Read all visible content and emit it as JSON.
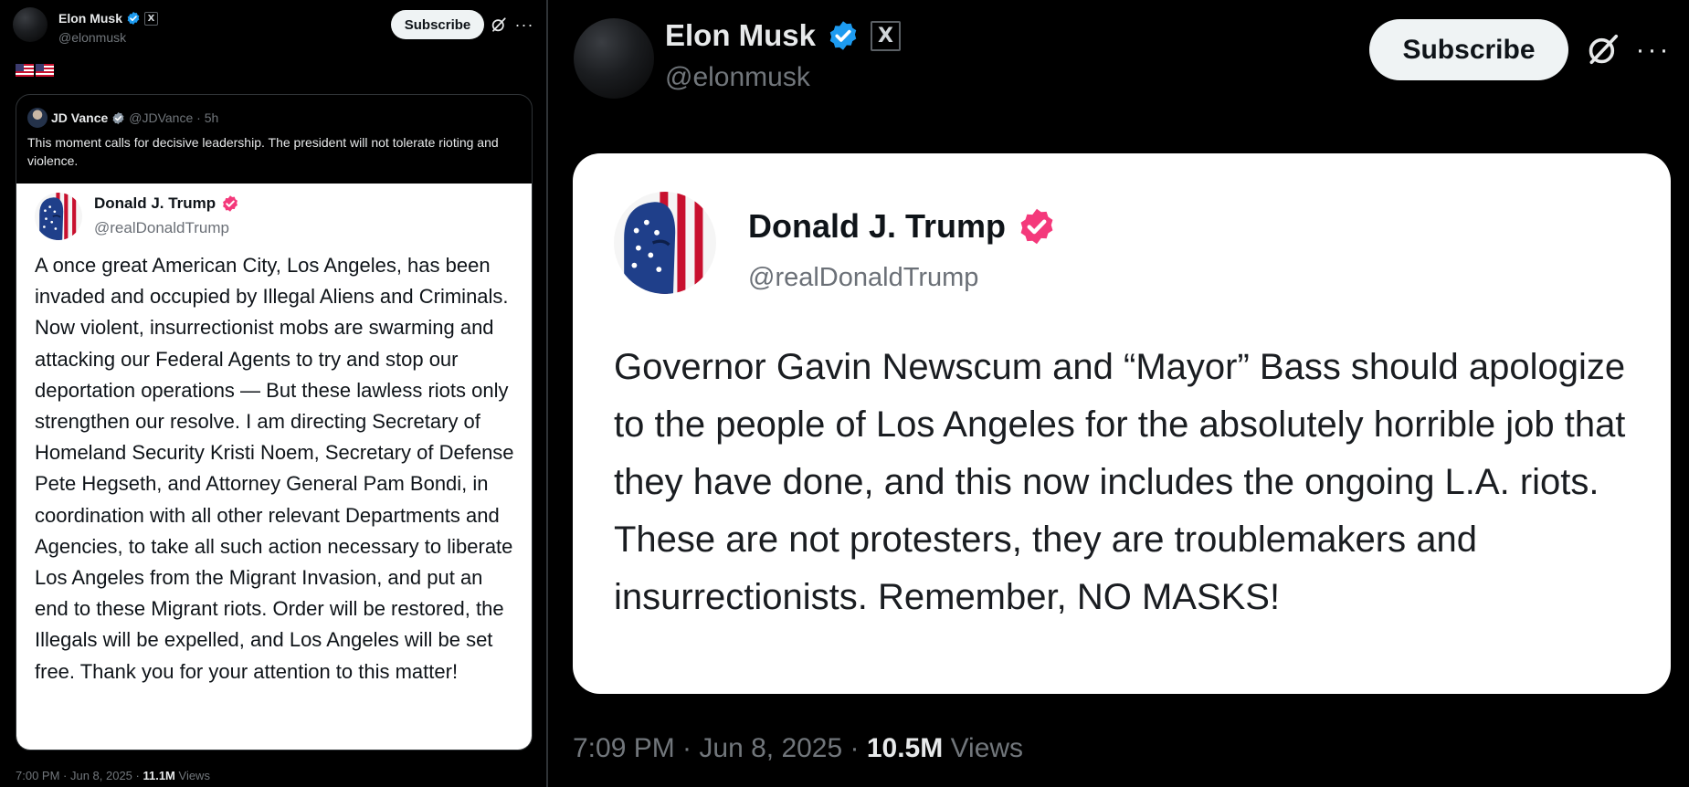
{
  "left": {
    "author": {
      "name": "Elon Musk",
      "handle": "@elonmusk",
      "affiliate_badge": "X"
    },
    "subscribe_label": "Subscribe",
    "more_label": "···",
    "flags": [
      "us-flag",
      "us-flag"
    ],
    "quote": {
      "name": "JD Vance",
      "handle": "@JDVance",
      "time": "· 5h",
      "text": "This moment calls for decisive leadership. The president will not tolerate rioting and violence."
    },
    "card": {
      "name": "Donald J. Trump",
      "handle": "@realDonaldTrump",
      "text": "A once great American City, Los Angeles, has been invaded and occupied by Illegal Aliens and Criminals.  Now violent, insurrectionist mobs are swarming and attacking our Federal Agents to try and stop our deportation operations — But these lawless riots only strengthen our resolve. I am directing Secretary of Homeland Security Kristi Noem, Secretary of Defense Pete Hegseth, and Attorney General Pam Bondi, in coordination with all other relevant Departments and Agencies, to take all such action necessary to liberate Los Angeles from the Migrant Invasion, and put an end to these Migrant riots. Order will be restored, the Illegals will be expelled, and Los Angeles will be set free. Thank you for your attention to this matter!"
    },
    "footer": {
      "time": "7:00 PM · Jun 8, 2025 · ",
      "views_count": "11.1M",
      "views_label": " Views"
    }
  },
  "right": {
    "author": {
      "name": "Elon Musk",
      "handle": "@elonmusk",
      "affiliate_badge": "X"
    },
    "subscribe_label": "Subscribe",
    "more_label": "···",
    "card": {
      "name": "Donald J. Trump",
      "handle": "@realDonaldTrump",
      "text": "Governor Gavin Newscum and “Mayor” Bass should apologize to the people of Los Angeles for the absolutely horrible job that they have done, and this now includes the ongoing L.A. riots. These are not protesters, they are troublemakers and insurrectionists. Remember, NO MASKS!"
    },
    "footer": {
      "time": "7:09 PM · Jun 8, 2025 · ",
      "views_count": "10.5M",
      "views_label": " Views"
    }
  },
  "colors": {
    "background": "#000000",
    "verified_blue": "#1d9bf0",
    "verified_pink": "#f4397b",
    "muted_text": "#71767b"
  },
  "icons": [
    "verified-badge-icon",
    "grok-icon",
    "more-icon",
    "x-affiliate-badge-icon"
  ]
}
